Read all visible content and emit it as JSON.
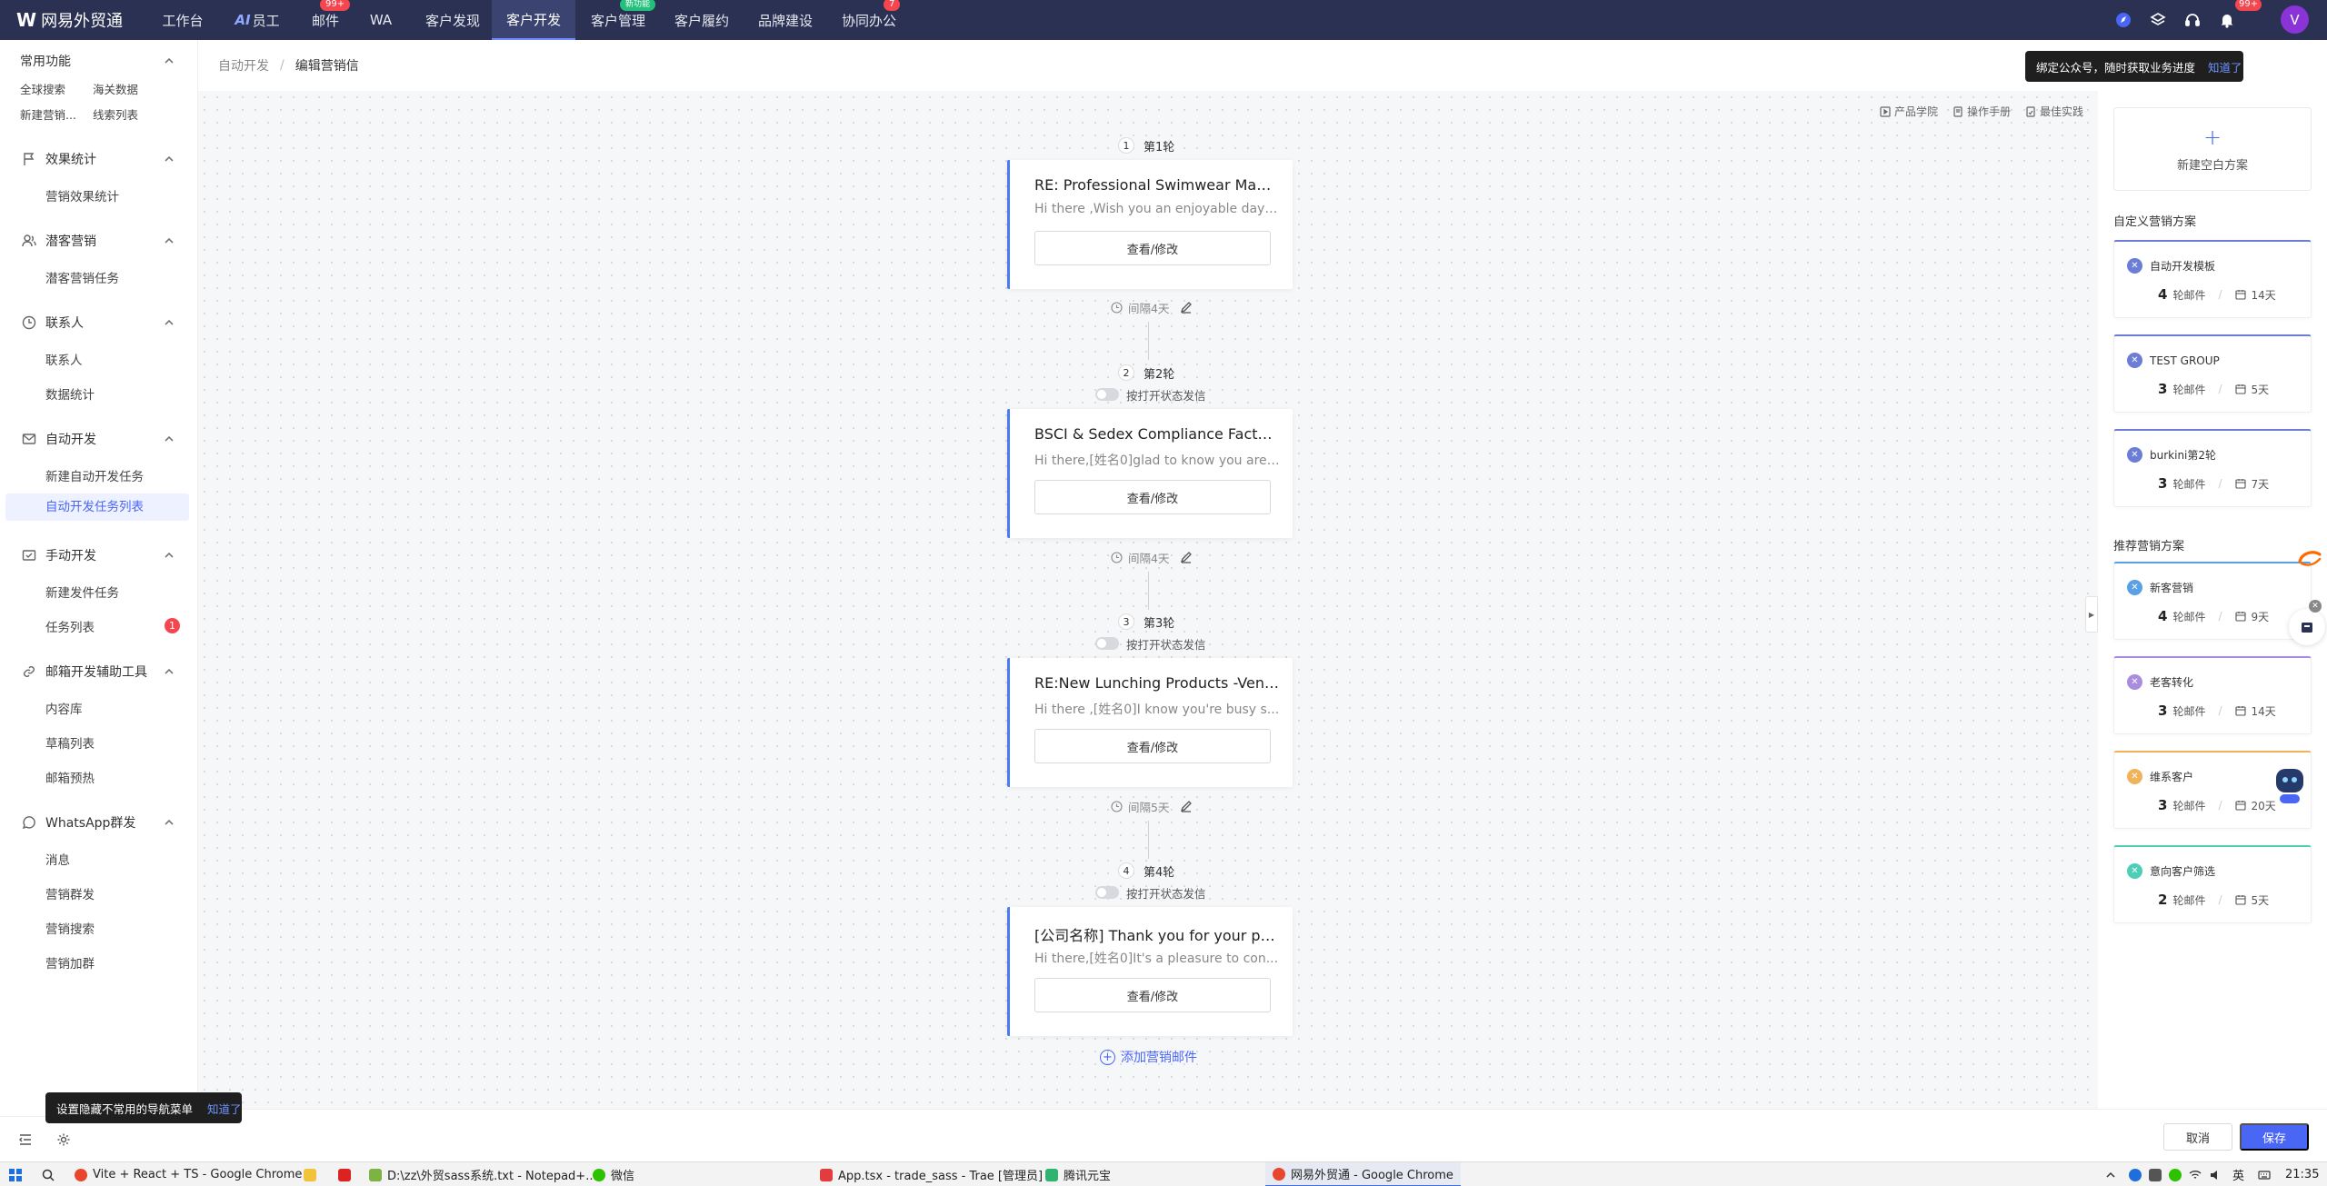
{
  "app": {
    "name": "网易外贸通",
    "logo_mark": "W"
  },
  "nav": [
    {
      "label": "工作台"
    },
    {
      "label": "员工",
      "prefix": "AI"
    },
    {
      "label": "邮件",
      "badge": "99+"
    },
    {
      "label": "WA"
    },
    {
      "label": "客户发现"
    },
    {
      "label": "客户开发",
      "active": true
    },
    {
      "label": "客户管理",
      "badge": "新功能"
    },
    {
      "label": "客户履约"
    },
    {
      "label": "品牌建设"
    },
    {
      "label": "协同办公",
      "badge": "7"
    }
  ],
  "topbar": {
    "bell_badge": "99+",
    "avatar": "V"
  },
  "sidebar": {
    "common": {
      "title": "常用功能",
      "links": [
        "全球搜索",
        "海关数据",
        "新建营销...",
        "线索列表"
      ]
    },
    "groups": [
      {
        "title": "效果统计",
        "icon": "flag-icon",
        "items": [
          "营销效果统计"
        ]
      },
      {
        "title": "潜客营销",
        "icon": "users-icon",
        "items": [
          "潜客营销任务"
        ]
      },
      {
        "title": "联系人",
        "icon": "clock-icon",
        "items": [
          "联系人",
          "数据统计"
        ]
      },
      {
        "title": "自动开发",
        "icon": "mail-icon",
        "items": [
          "新建自动开发任务",
          "自动开发任务列表"
        ]
      },
      {
        "title": "手动开发",
        "icon": "send-icon",
        "items": [
          "新建发件任务",
          "任务列表"
        ]
      },
      {
        "title": "邮箱开发辅助工具",
        "icon": "link-icon",
        "items": [
          "内容库",
          "草稿列表",
          "邮箱预热"
        ]
      },
      {
        "title": "WhatsApp群发",
        "icon": "whatsapp-icon",
        "items": [
          "消息",
          "营销群发",
          "营销搜索",
          "营销加群"
        ]
      }
    ],
    "active_item": "自动开发任务列表",
    "task_list_count": "1",
    "toast": {
      "text": "设置隐藏不常用的导航菜单",
      "link": "知道了"
    }
  },
  "breadcrumb": {
    "parent": "自动开发",
    "sep": "/",
    "current": "编辑营销信"
  },
  "canvas_links": [
    "产品学院",
    "操作手册",
    "最佳实践"
  ],
  "rounds": [
    {
      "num": "1",
      "label": "第1轮",
      "title": "RE: Professional Swimwear Manufacturer",
      "body": "Hi there ,Wish you an enjoyable day!...",
      "button": "查看/修改",
      "interval": "间隔4天"
    },
    {
      "num": "2",
      "label": "第2轮",
      "toggle": "按打开状态发信",
      "title": "BSCI & Sedex Compliance Factory",
      "body": "Hi there,[姓名0]glad to know you are ...",
      "button": "查看/修改",
      "interval": "间隔4天"
    },
    {
      "num": "3",
      "label": "第3轮",
      "toggle": "按打开状态发信",
      "title": "RE:New Lunching Products -Vendor",
      "body": "Hi there ,[姓名0]I know you're busy s...",
      "button": "查看/修改",
      "interval": "间隔5天"
    },
    {
      "num": "4",
      "label": "第4轮",
      "toggle": "按打开状态发信",
      "title": "[公司名称] Thank you for your patience",
      "body": "Hi there,[姓名0]It's a pleasure to con...",
      "button": "查看/修改"
    }
  ],
  "add_mail": "添加营销邮件",
  "right_panel": {
    "new_plan": "新建空白方案",
    "custom_title": "自定义营销方案",
    "custom": [
      {
        "name": "自动开发模板",
        "rounds": "4",
        "unit": "轮邮件",
        "days": "14天",
        "color": "#6c7dd8"
      },
      {
        "name": "TEST GROUP",
        "rounds": "3",
        "unit": "轮邮件",
        "days": "5天",
        "color": "#6c7dd8"
      },
      {
        "name": "burkini第2轮",
        "rounds": "3",
        "unit": "轮邮件",
        "days": "7天",
        "color": "#6c7dd8"
      }
    ],
    "recommend_title": "推荐营销方案",
    "recommend": [
      {
        "name": "新客营销",
        "rounds": "4",
        "unit": "轮邮件",
        "days": "9天",
        "color": "#5aa0e6"
      },
      {
        "name": "老客转化",
        "rounds": "3",
        "unit": "轮邮件",
        "days": "14天",
        "color": "#a98be0"
      },
      {
        "name": "维系客户",
        "rounds": "3",
        "unit": "轮邮件",
        "days": "20天",
        "color": "#f0b35c"
      },
      {
        "name": "意向客户筛选",
        "rounds": "2",
        "unit": "轮邮件",
        "days": "5天",
        "color": "#4ecfb5"
      }
    ],
    "toast": {
      "text": "绑定公众号，随时获取业务进度",
      "link": "知道了"
    }
  },
  "actions": {
    "cancel": "取消",
    "save": "保存"
  },
  "taskbar": {
    "items": [
      "Vite + React + TS - Google Chrome",
      "D:\\zz\\外贸sass系统.txt - Notepad+...",
      "微信",
      "App.tsx - trade_sass - Trae [管理员]",
      "腾讯元宝",
      "网易外贸通 - Google Chrome"
    ],
    "ime": "英",
    "clock": "21:35"
  }
}
